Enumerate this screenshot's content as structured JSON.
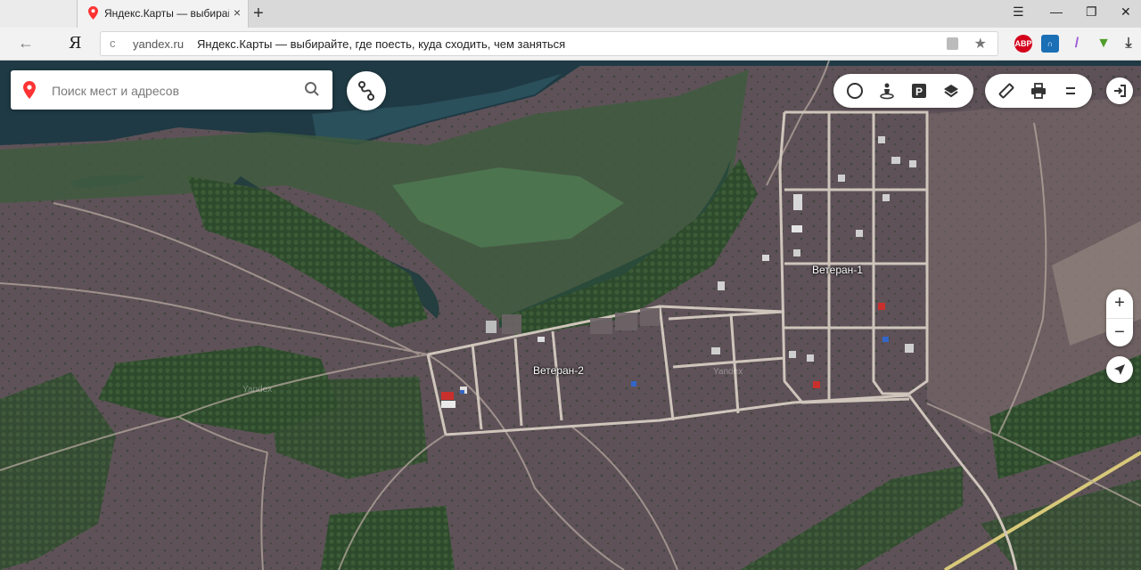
{
  "browser": {
    "tab": {
      "title": "Яндекс.Карты — выбирайте, где поесть, куда сходить, чем заняться",
      "close": "×"
    },
    "new_tab": "+",
    "window": {
      "menu": "☰",
      "minimize": "—",
      "restore": "❐",
      "close": "✕"
    },
    "back": "←",
    "logo": "Я",
    "address": {
      "reload": "c",
      "domain": "yandex.ru",
      "page_title": "Яндекс.Карты — выбирайте, где поесть, куда сходить, чем заняться",
      "star": "★"
    },
    "extensions": [
      {
        "name": "abp",
        "label": "ABP",
        "color": "#d4001c"
      },
      {
        "name": "headphones",
        "label": "∩",
        "color": "#1a6fb5"
      },
      {
        "name": "pen",
        "label": "/",
        "color": "#9c5bd6"
      },
      {
        "name": "leaf",
        "label": "▼",
        "color": "#4f9d2a"
      },
      {
        "name": "download",
        "label": "⤓",
        "color": "#444444"
      }
    ]
  },
  "map": {
    "search": {
      "placeholder": "Поиск мест и адресов"
    },
    "labels": {
      "veteran1": "Ветеран-1",
      "veteran2": "Ветеран-2"
    },
    "zoom": {
      "in": "+",
      "out": "−"
    },
    "colors": {
      "accent_pin": "#f33",
      "road": "#c9bfb4",
      "field": "#5d4f56",
      "forest": "#2f4a2e",
      "water": "#1f3a44"
    }
  }
}
